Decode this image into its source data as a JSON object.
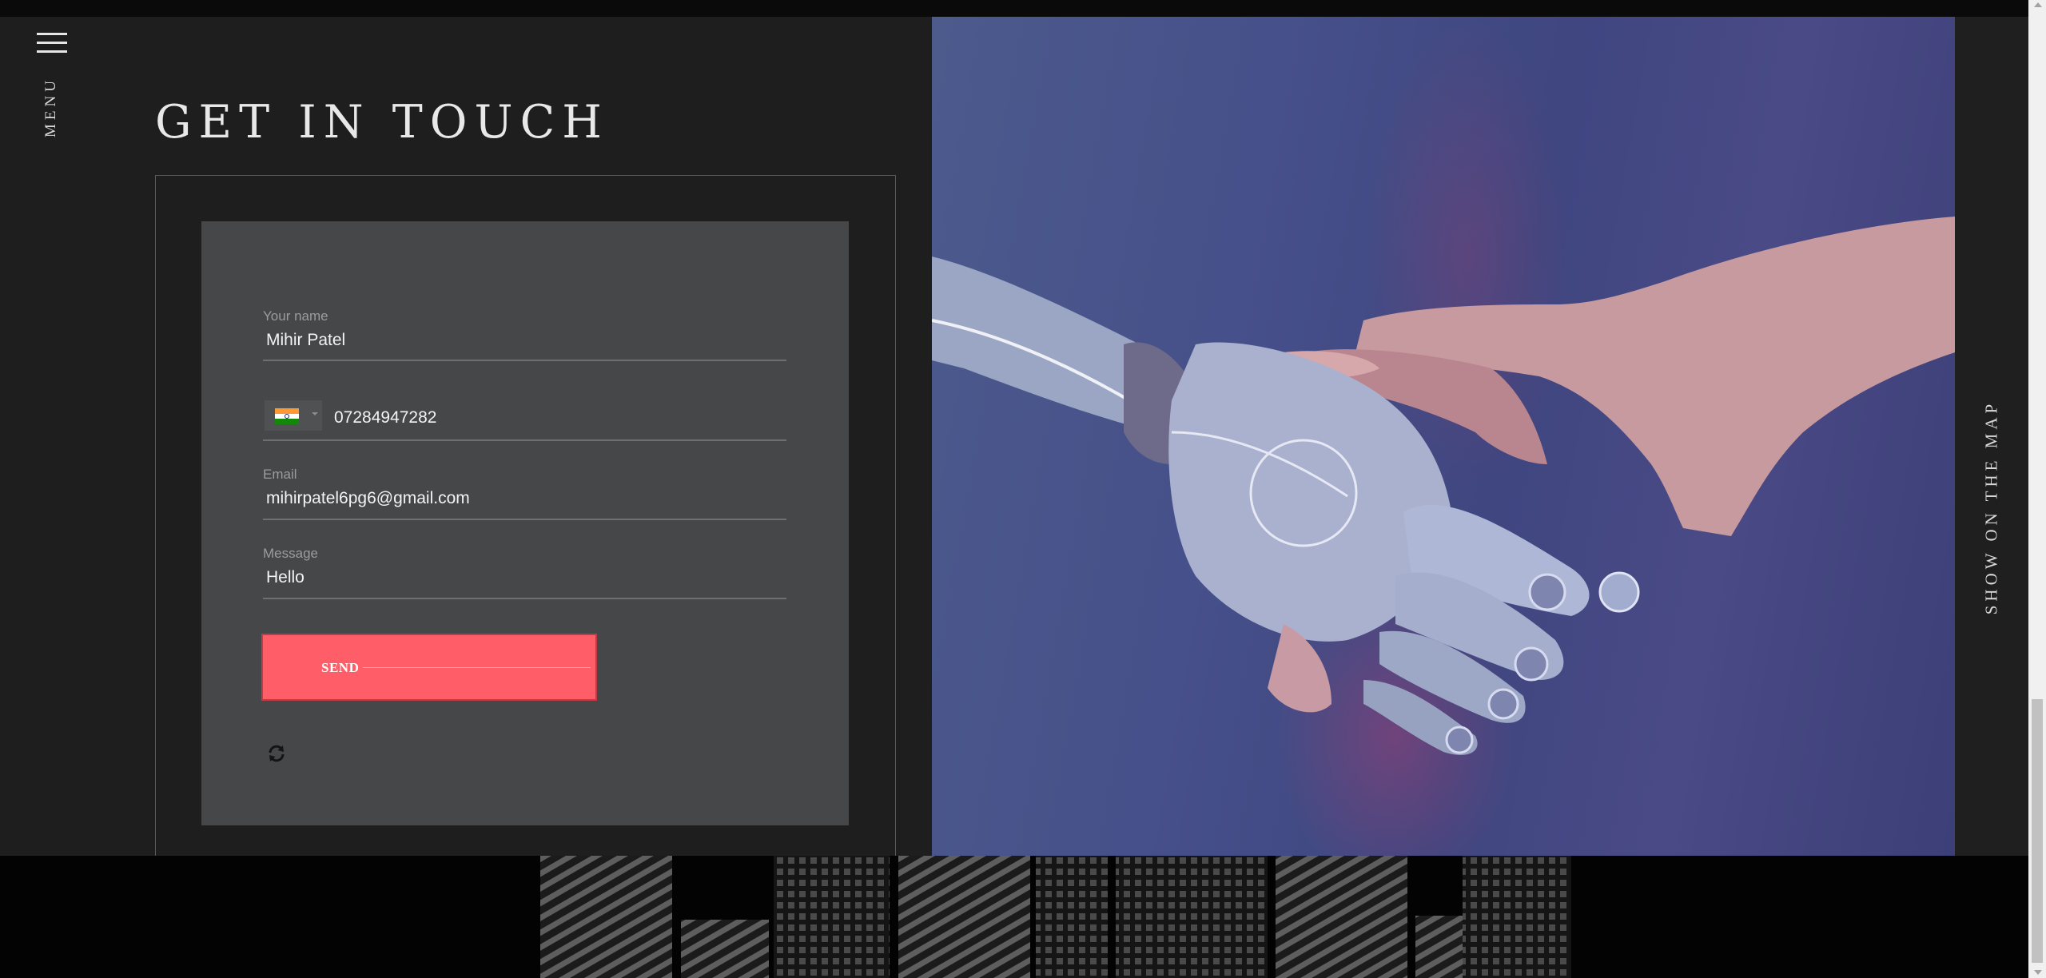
{
  "nav": {
    "menu_label": "MENU",
    "menu_icon": "hamburger-icon"
  },
  "page": {
    "title": "GET IN TOUCH"
  },
  "form": {
    "name": {
      "label": "Your name",
      "value": "Mihir Patel"
    },
    "phone": {
      "country_flag": "india-flag-icon",
      "value": "07284947282"
    },
    "email": {
      "label": "Email",
      "value": "mihirpatel6pg6@gmail.com"
    },
    "message": {
      "label": "Message",
      "value": "Hello"
    },
    "send_label": "SEND",
    "captcha_refresh_icon": "refresh-icon"
  },
  "side": {
    "map_label": "SHOW ON THE MAP"
  },
  "colors": {
    "page_bg": "#1e1e1e",
    "form_panel_bg": "#454748",
    "send_button": "#ff5d68",
    "footer_bg": "#030303"
  }
}
